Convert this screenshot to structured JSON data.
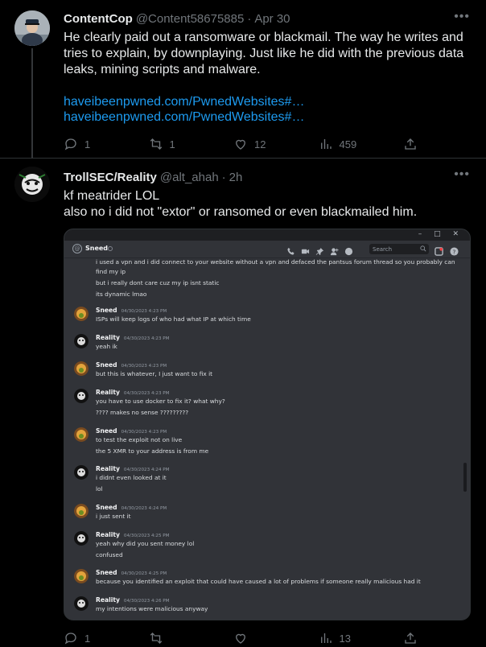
{
  "tweet1": {
    "author_name": "ContentCop",
    "handle": "@Content58675885",
    "time": "Apr 30",
    "text": "He clearly paid out a ransomware or blackmail. The way he writes and tries to explain, by downplaying. Just like he did with the previous data leaks, mining scripts and malware.",
    "links": [
      "haveibeenpwned.com/PwnedWebsites#…",
      "haveibeenpwned.com/PwnedWebsites#…"
    ],
    "stats": {
      "replies": "1",
      "retweets": "1",
      "likes": "12",
      "views": "459"
    }
  },
  "tweet2": {
    "author_name": "TrollSEC/Reality",
    "handle": "@alt_ahah",
    "time": "2h",
    "text_line1": "kf meatrider LOL",
    "text_line2": "also no i did not \"extor\" or ransomed or even blackmailed him.",
    "stats": {
      "replies": "1",
      "retweets": "",
      "likes": "",
      "views": "13"
    }
  },
  "discord": {
    "channel": "Sneed",
    "search_placeholder": "Search",
    "window_controls": "– □ ✕",
    "continued_lines": [
      "i used a vpn and i did connect to your website without a vpn and defaced the pantsus forum thread so you probably can",
      "find my ip",
      "but i really dont care cuz my ip isnt static",
      "its dynamic lmao"
    ],
    "messages": [
      {
        "author": "Sneed",
        "time": "04/30/2023 4:23 PM",
        "lines": [
          "ISPs will keep logs of who had what IP at which time"
        ]
      },
      {
        "author": "Reality",
        "time": "04/30/2023 4:23 PM",
        "lines": [
          "yeah ik"
        ]
      },
      {
        "author": "Sneed",
        "time": "04/30/2023 4:23 PM",
        "lines": [
          "but this is whatever, I just want to fix it"
        ]
      },
      {
        "author": "Reality",
        "time": "04/30/2023 4:23 PM",
        "lines": [
          "you have to use docker to fix it? what why?",
          "???? makes no sense ?????????"
        ]
      },
      {
        "author": "Sneed",
        "time": "04/30/2023 4:23 PM",
        "lines": [
          "to test the exploit not on live",
          "the 5 XMR to your address is from me"
        ]
      },
      {
        "author": "Reality",
        "time": "04/30/2023 4:24 PM",
        "lines": [
          "i didnt even looked at it",
          "lol"
        ]
      },
      {
        "author": "Sneed",
        "time": "04/30/2023 4:24 PM",
        "lines": [
          "i just sent it"
        ]
      },
      {
        "author": "Reality",
        "time": "04/30/2023 4:25 PM",
        "lines": [
          "yeah why did you sent money lol",
          "confused"
        ]
      },
      {
        "author": "Sneed",
        "time": "04/30/2023 4:25 PM",
        "lines": [
          "because you identified an exploit that could have caused a lot of problems if someone really malicious had it"
        ]
      },
      {
        "author": "Reality",
        "time": "04/30/2023 4:26 PM",
        "lines": [
          "my intentions were malicious anyway"
        ]
      }
    ]
  },
  "colors": {
    "background": "#000000",
    "text": "#e7e9ea",
    "muted": "#71767b",
    "link": "#1d9bf0",
    "discord_bg": "#313338"
  },
  "icons": [
    "reply-icon",
    "retweet-icon",
    "like-icon",
    "views-icon",
    "share-icon",
    "more-icon"
  ]
}
